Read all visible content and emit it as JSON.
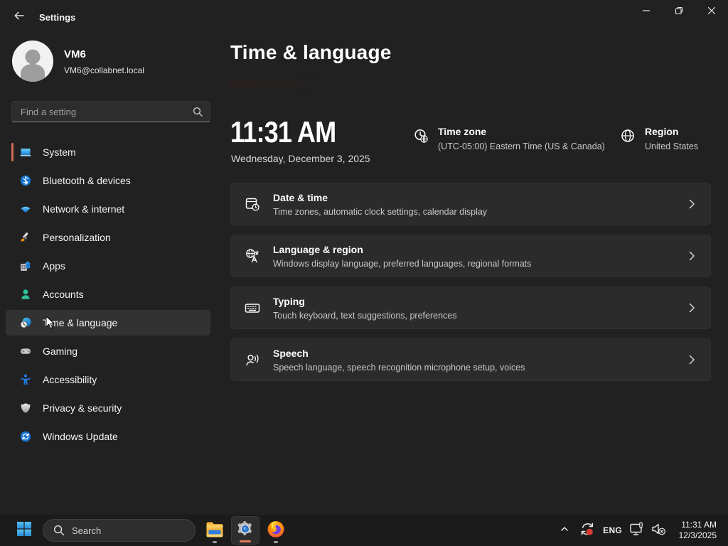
{
  "window": {
    "title": "Settings",
    "caption_buttons": {
      "minimize": "minimize",
      "restore": "restore",
      "close": "close"
    }
  },
  "user": {
    "name": "VM6",
    "email": "VM6@collabnet.local"
  },
  "sidebar": {
    "search_placeholder": "Find a setting",
    "items": [
      {
        "label": "System",
        "icon": "system"
      },
      {
        "label": "Bluetooth & devices",
        "icon": "bluetooth"
      },
      {
        "label": "Network & internet",
        "icon": "network"
      },
      {
        "label": "Personalization",
        "icon": "personalization"
      },
      {
        "label": "Apps",
        "icon": "apps"
      },
      {
        "label": "Accounts",
        "icon": "accounts"
      },
      {
        "label": "Time & language",
        "icon": "time"
      },
      {
        "label": "Gaming",
        "icon": "gaming"
      },
      {
        "label": "Accessibility",
        "icon": "accessibility"
      },
      {
        "label": "Privacy & security",
        "icon": "privacy"
      },
      {
        "label": "Windows Update",
        "icon": "update"
      }
    ],
    "accent_item": "System",
    "hovered_item": "Time & language"
  },
  "page": {
    "title": "Time & language",
    "clock_time": "11:31 AM",
    "clock_date": "Wednesday, December 3, 2025",
    "timezone": {
      "label": "Time zone",
      "value": "(UTC-05:00) Eastern Time (US & Canada)"
    },
    "region": {
      "label": "Region",
      "value": "United States"
    },
    "cards": [
      {
        "title": "Date & time",
        "subtitle": "Time zones, automatic clock settings, calendar display",
        "icon": "datetime"
      },
      {
        "title": "Language & region",
        "subtitle": "Windows display language, preferred languages, regional formats",
        "icon": "langregion"
      },
      {
        "title": "Typing",
        "subtitle": "Touch keyboard, text suggestions, preferences",
        "icon": "typing"
      },
      {
        "title": "Speech",
        "subtitle": "Speech language, speech recognition microphone setup, voices",
        "icon": "speech"
      }
    ]
  },
  "taskbar": {
    "search_label": "Search",
    "apps": [
      "file-explorer",
      "settings",
      "firefox"
    ],
    "tray": {
      "language": "ENG",
      "time": "11:31 AM",
      "date": "12/3/2025"
    }
  },
  "colors": {
    "accent": "#ce6b51",
    "window_bg": "#212121",
    "card_bg": "#2b2b2b",
    "taskbar_bg": "#1b1b1b"
  }
}
